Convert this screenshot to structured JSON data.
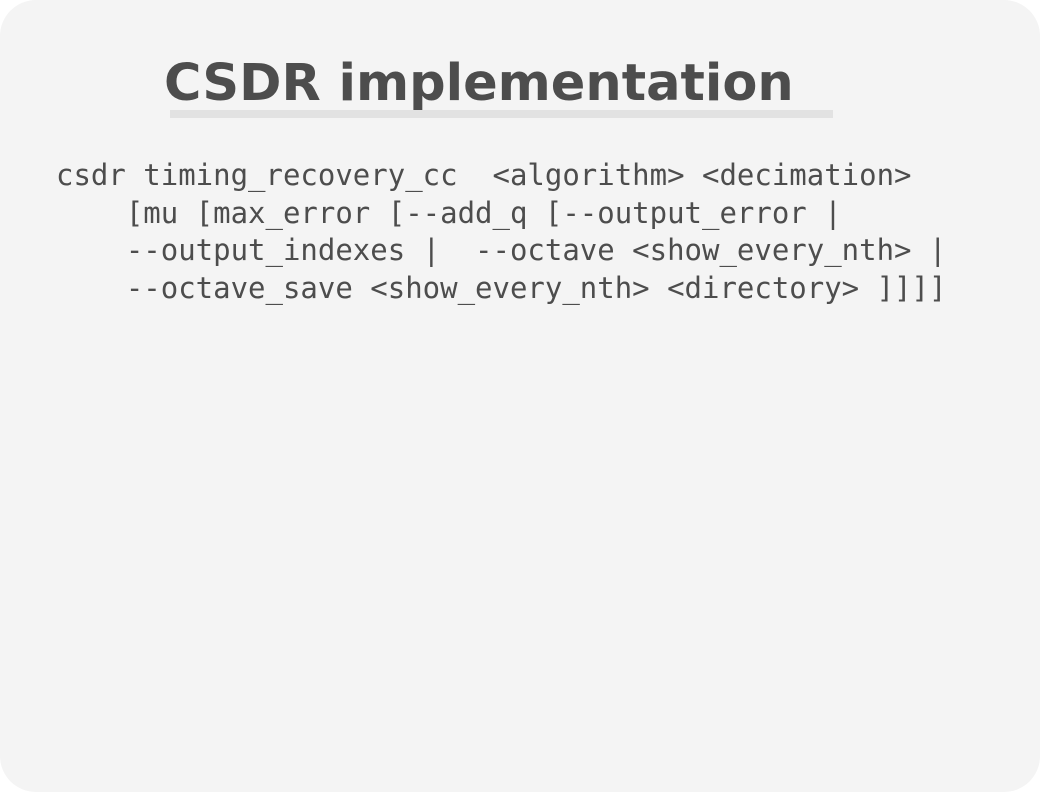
{
  "slide": {
    "title": "CSDR implementation",
    "code_lines": [
      "csdr timing_recovery_cc  <algorithm> <decimation>",
      "    [mu [max_error [--add_q [--output_error |",
      "    --output_indexes |  --octave <show_every_nth> |",
      "    --octave_save <show_every_nth> <directory> ]]]]"
    ]
  }
}
